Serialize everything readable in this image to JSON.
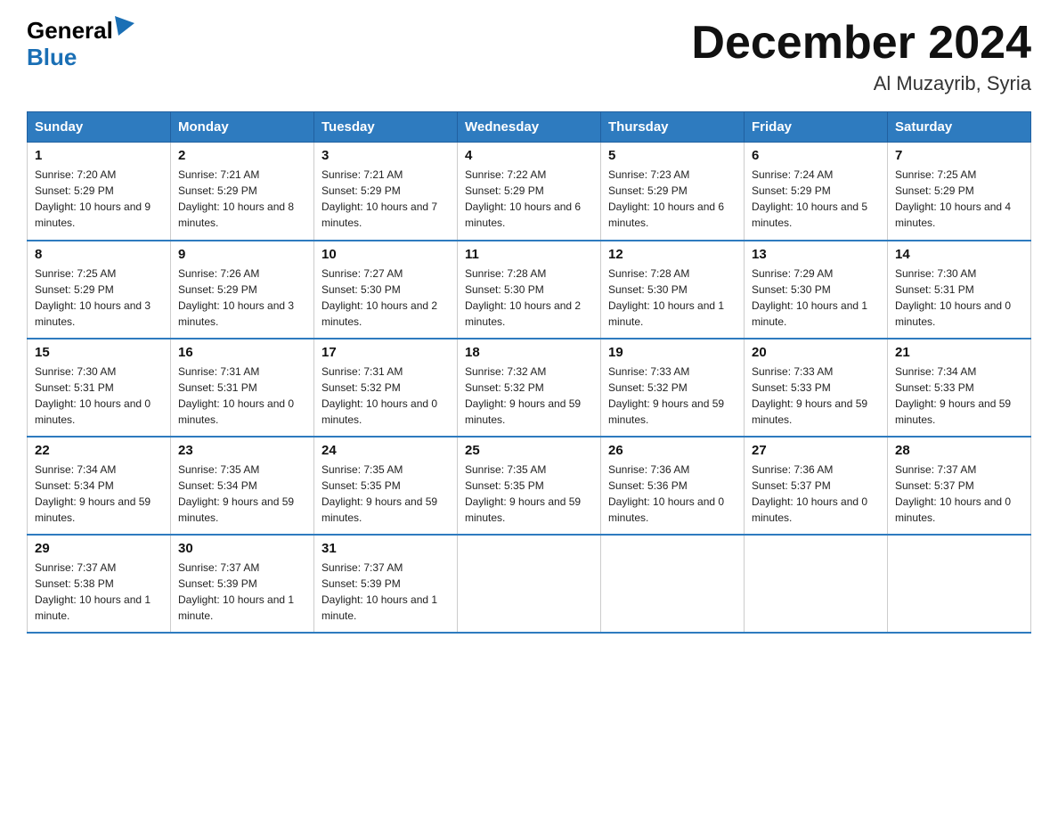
{
  "header": {
    "logo_general": "General",
    "logo_blue": "Blue",
    "month_title": "December 2024",
    "location": "Al Muzayrib, Syria"
  },
  "weekdays": [
    "Sunday",
    "Monday",
    "Tuesday",
    "Wednesday",
    "Thursday",
    "Friday",
    "Saturday"
  ],
  "weeks": [
    [
      {
        "day": "1",
        "sunrise": "7:20 AM",
        "sunset": "5:29 PM",
        "daylight": "10 hours and 9 minutes."
      },
      {
        "day": "2",
        "sunrise": "7:21 AM",
        "sunset": "5:29 PM",
        "daylight": "10 hours and 8 minutes."
      },
      {
        "day": "3",
        "sunrise": "7:21 AM",
        "sunset": "5:29 PM",
        "daylight": "10 hours and 7 minutes."
      },
      {
        "day": "4",
        "sunrise": "7:22 AM",
        "sunset": "5:29 PM",
        "daylight": "10 hours and 6 minutes."
      },
      {
        "day": "5",
        "sunrise": "7:23 AM",
        "sunset": "5:29 PM",
        "daylight": "10 hours and 6 minutes."
      },
      {
        "day": "6",
        "sunrise": "7:24 AM",
        "sunset": "5:29 PM",
        "daylight": "10 hours and 5 minutes."
      },
      {
        "day": "7",
        "sunrise": "7:25 AM",
        "sunset": "5:29 PM",
        "daylight": "10 hours and 4 minutes."
      }
    ],
    [
      {
        "day": "8",
        "sunrise": "7:25 AM",
        "sunset": "5:29 PM",
        "daylight": "10 hours and 3 minutes."
      },
      {
        "day": "9",
        "sunrise": "7:26 AM",
        "sunset": "5:29 PM",
        "daylight": "10 hours and 3 minutes."
      },
      {
        "day": "10",
        "sunrise": "7:27 AM",
        "sunset": "5:30 PM",
        "daylight": "10 hours and 2 minutes."
      },
      {
        "day": "11",
        "sunrise": "7:28 AM",
        "sunset": "5:30 PM",
        "daylight": "10 hours and 2 minutes."
      },
      {
        "day": "12",
        "sunrise": "7:28 AM",
        "sunset": "5:30 PM",
        "daylight": "10 hours and 1 minute."
      },
      {
        "day": "13",
        "sunrise": "7:29 AM",
        "sunset": "5:30 PM",
        "daylight": "10 hours and 1 minute."
      },
      {
        "day": "14",
        "sunrise": "7:30 AM",
        "sunset": "5:31 PM",
        "daylight": "10 hours and 0 minutes."
      }
    ],
    [
      {
        "day": "15",
        "sunrise": "7:30 AM",
        "sunset": "5:31 PM",
        "daylight": "10 hours and 0 minutes."
      },
      {
        "day": "16",
        "sunrise": "7:31 AM",
        "sunset": "5:31 PM",
        "daylight": "10 hours and 0 minutes."
      },
      {
        "day": "17",
        "sunrise": "7:31 AM",
        "sunset": "5:32 PM",
        "daylight": "10 hours and 0 minutes."
      },
      {
        "day": "18",
        "sunrise": "7:32 AM",
        "sunset": "5:32 PM",
        "daylight": "9 hours and 59 minutes."
      },
      {
        "day": "19",
        "sunrise": "7:33 AM",
        "sunset": "5:32 PM",
        "daylight": "9 hours and 59 minutes."
      },
      {
        "day": "20",
        "sunrise": "7:33 AM",
        "sunset": "5:33 PM",
        "daylight": "9 hours and 59 minutes."
      },
      {
        "day": "21",
        "sunrise": "7:34 AM",
        "sunset": "5:33 PM",
        "daylight": "9 hours and 59 minutes."
      }
    ],
    [
      {
        "day": "22",
        "sunrise": "7:34 AM",
        "sunset": "5:34 PM",
        "daylight": "9 hours and 59 minutes."
      },
      {
        "day": "23",
        "sunrise": "7:35 AM",
        "sunset": "5:34 PM",
        "daylight": "9 hours and 59 minutes."
      },
      {
        "day": "24",
        "sunrise": "7:35 AM",
        "sunset": "5:35 PM",
        "daylight": "9 hours and 59 minutes."
      },
      {
        "day": "25",
        "sunrise": "7:35 AM",
        "sunset": "5:35 PM",
        "daylight": "9 hours and 59 minutes."
      },
      {
        "day": "26",
        "sunrise": "7:36 AM",
        "sunset": "5:36 PM",
        "daylight": "10 hours and 0 minutes."
      },
      {
        "day": "27",
        "sunrise": "7:36 AM",
        "sunset": "5:37 PM",
        "daylight": "10 hours and 0 minutes."
      },
      {
        "day": "28",
        "sunrise": "7:37 AM",
        "sunset": "5:37 PM",
        "daylight": "10 hours and 0 minutes."
      }
    ],
    [
      {
        "day": "29",
        "sunrise": "7:37 AM",
        "sunset": "5:38 PM",
        "daylight": "10 hours and 1 minute."
      },
      {
        "day": "30",
        "sunrise": "7:37 AM",
        "sunset": "5:39 PM",
        "daylight": "10 hours and 1 minute."
      },
      {
        "day": "31",
        "sunrise": "7:37 AM",
        "sunset": "5:39 PM",
        "daylight": "10 hours and 1 minute."
      },
      null,
      null,
      null,
      null
    ]
  ],
  "colors": {
    "header_bg": "#2e7bbf",
    "header_text": "#ffffff",
    "border": "#2e7bbf"
  }
}
